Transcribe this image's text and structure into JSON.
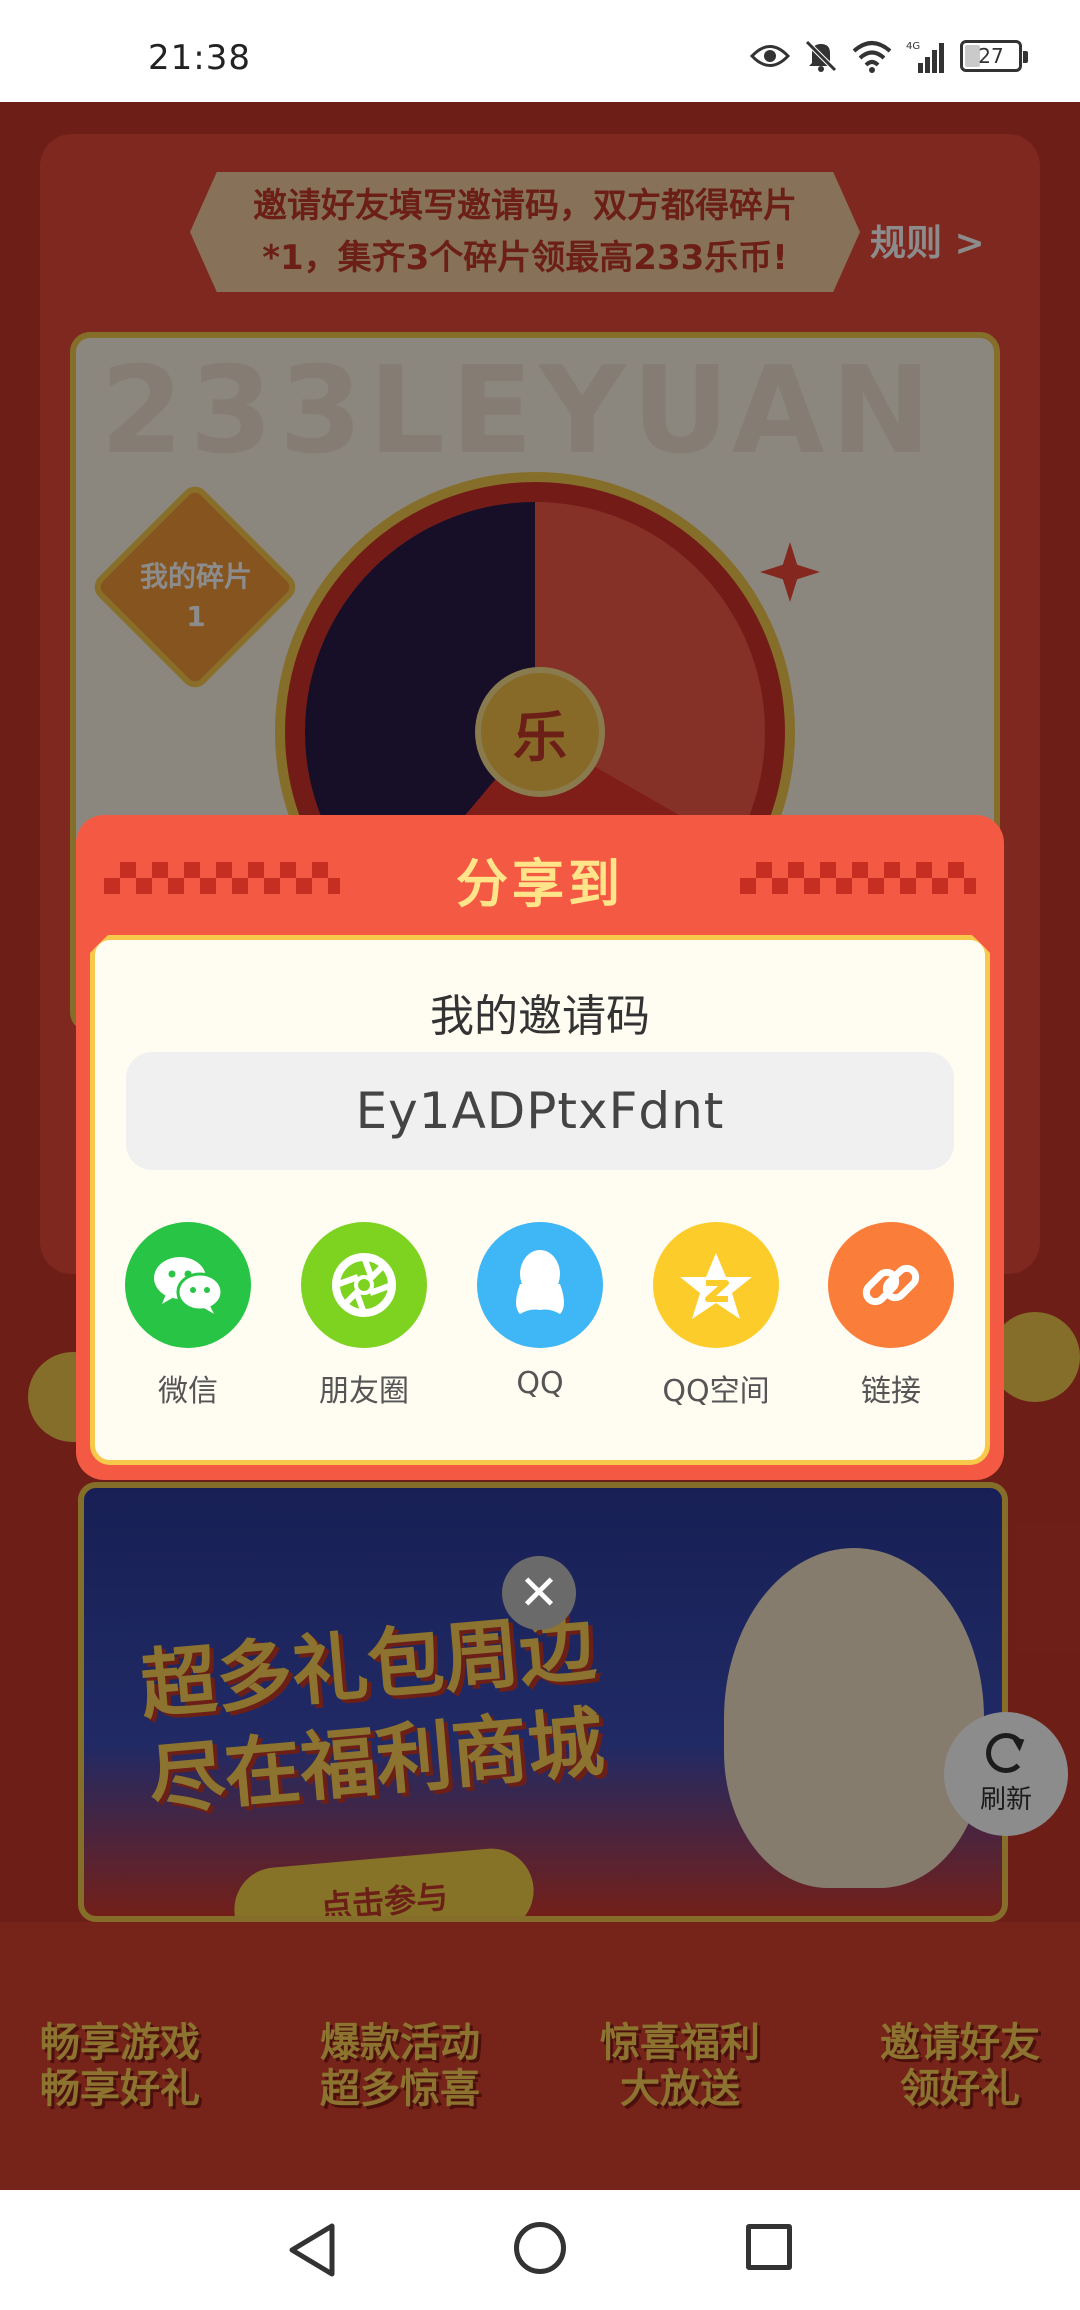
{
  "status_bar": {
    "time": "21:38",
    "battery_level": "27",
    "icons": [
      "eye-icon",
      "bell-off-icon",
      "wifi-icon",
      "signal-4g-icon",
      "battery-icon"
    ]
  },
  "background": {
    "ribbon_text": "邀请好友填写邀请码，双方都得碎片*1，集齐3个碎片领最高233乐币!",
    "rules_link": "规则 >",
    "watermark": "233LEYUAN",
    "fragment_label": "我的碎片",
    "fragment_count": "1",
    "wheel_center": "乐",
    "mall_title_line1": "超多礼包周边",
    "mall_title_line2": "尽在福利商城",
    "mall_cta": "点击参与",
    "refresh_label": "刷新",
    "features": [
      {
        "line1": "畅享游戏",
        "line2": "畅享好礼"
      },
      {
        "line1": "爆款活动",
        "line2": "超多惊喜"
      },
      {
        "line1": "惊喜福利",
        "line2": "大放送"
      },
      {
        "line1": "邀请好友",
        "line2": "领好礼"
      }
    ]
  },
  "dialog": {
    "title": "分享到",
    "invite_label": "我的邀请码",
    "invite_code": "Ey1ADPtxFdnt",
    "share_targets": [
      {
        "label": "微信",
        "icon": "wechat-icon",
        "color": "#28c445"
      },
      {
        "label": "朋友圈",
        "icon": "moments-icon",
        "color": "#7ed321"
      },
      {
        "label": "QQ",
        "icon": "qq-icon",
        "color": "#3fb6f5"
      },
      {
        "label": "QQ空间",
        "icon": "qzone-icon",
        "color": "#fccd2a"
      },
      {
        "label": "链接",
        "icon": "link-icon",
        "color": "#fb7d3a"
      }
    ],
    "close_glyph": "✕"
  },
  "nav_bar": {
    "icons": [
      "back-icon",
      "home-icon",
      "recents-icon"
    ]
  }
}
